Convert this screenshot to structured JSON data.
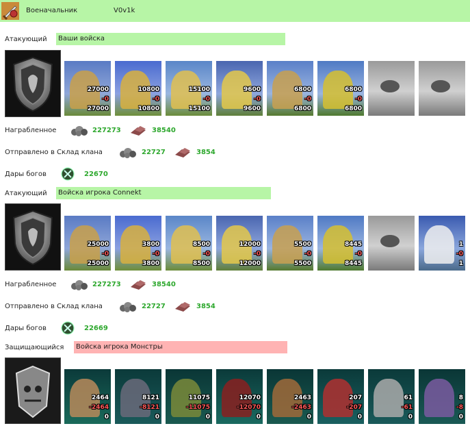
{
  "header": {
    "title": "Военачальник",
    "player": "V0v1k"
  },
  "labels": {
    "attacker": "Атакующий",
    "defender": "Защищающийся",
    "loot": "Награбленное",
    "sent_to_clan": "Отправлено в Склад клана",
    "gods_gifts": "Дары богов"
  },
  "sections": [
    {
      "role": "Атакующий",
      "name": "Ваши войска",
      "units": [
        {
          "a": "27000",
          "b": "-0",
          "c": "27000",
          "kind": "cavalry"
        },
        {
          "a": "10800",
          "b": "-0",
          "c": "10800",
          "kind": "paladin"
        },
        {
          "a": "15100",
          "b": "-0",
          "c": "15100",
          "kind": "knight"
        },
        {
          "a": "9600",
          "b": "-0",
          "c": "9600",
          "kind": "griffin"
        },
        {
          "a": "6800",
          "b": "-0",
          "c": "6800",
          "kind": "archer"
        },
        {
          "a": "6800",
          "b": "-0",
          "c": "6800",
          "kind": "monk"
        },
        {
          "kind": "empty"
        },
        {
          "kind": "empty"
        }
      ],
      "loot": {
        "ore": "227273",
        "res": "38540"
      },
      "sent": {
        "ore": "22727",
        "res": "3854"
      },
      "gifts": "22670"
    },
    {
      "role": "Атакующий",
      "name": "Войска игрока Connekt",
      "units": [
        {
          "a": "25000",
          "b": "-0",
          "c": "25000",
          "kind": "cavalry"
        },
        {
          "a": "3800",
          "b": "-0",
          "c": "3800",
          "kind": "paladin"
        },
        {
          "a": "8500",
          "b": "-0",
          "c": "8500",
          "kind": "knight"
        },
        {
          "a": "12000",
          "b": "-0",
          "c": "12000",
          "kind": "griffin"
        },
        {
          "a": "5500",
          "b": "-0",
          "c": "5500",
          "kind": "archer"
        },
        {
          "a": "8445",
          "b": "-0",
          "c": "8445",
          "kind": "monk"
        },
        {
          "kind": "empty"
        },
        {
          "a": "1",
          "b": "-0",
          "c": "1",
          "kind": "mage"
        }
      ],
      "loot": {
        "ore": "227273",
        "res": "38540"
      },
      "sent": {
        "ore": "22727",
        "res": "3854"
      },
      "gifts": "22669"
    }
  ],
  "defender": {
    "role": "Защищающийся",
    "name": "Войска игрока Монстры",
    "units": [
      {
        "a": "2464",
        "b": "-2464",
        "c": "0",
        "kind": "m1"
      },
      {
        "a": "8121",
        "b": "-8121",
        "c": "0",
        "kind": "m2"
      },
      {
        "a": "11075",
        "b": "-11075",
        "c": "0",
        "kind": "m3"
      },
      {
        "a": "12070",
        "b": "-12070",
        "c": "0",
        "kind": "m4"
      },
      {
        "a": "2463",
        "b": "-2463",
        "c": "0",
        "kind": "m5"
      },
      {
        "a": "207",
        "b": "-207",
        "c": "0",
        "kind": "m6"
      },
      {
        "a": "61",
        "b": "-61",
        "c": "0",
        "kind": "m7"
      },
      {
        "a": "8",
        "b": "-8",
        "c": "0",
        "kind": "m8"
      }
    ]
  },
  "colors": {
    "green_bar": "#b7f5a6",
    "pink_bar": "#ffb3b3",
    "value_green": "#2ea82e",
    "loss_red": "#ff5a5a"
  }
}
